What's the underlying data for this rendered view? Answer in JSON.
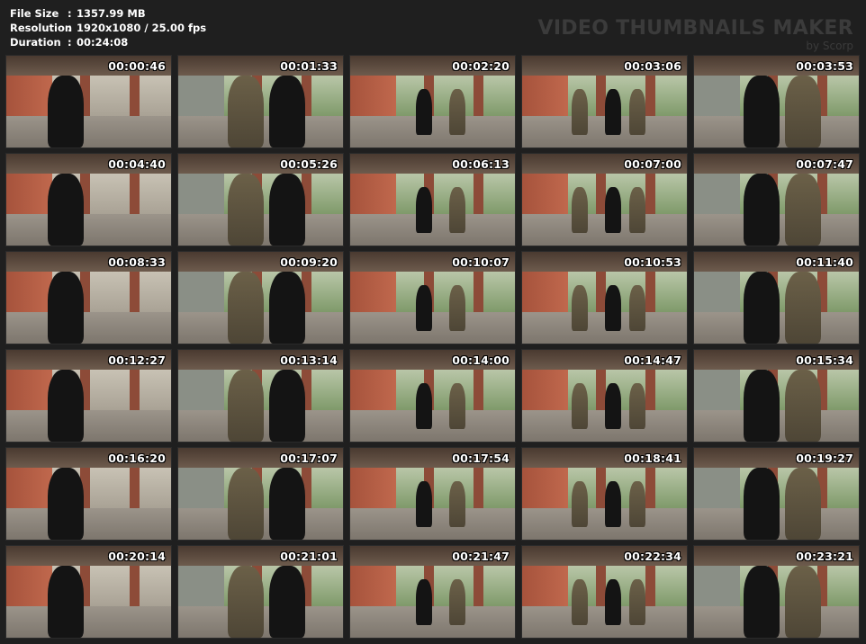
{
  "info": {
    "file_size_label": "File Size",
    "file_size_value": "1357.99 MB",
    "resolution_label": "Resolution",
    "resolution_value": "1920x1080 / 25.00 fps",
    "duration_label": "Duration",
    "duration_value": "00:24:08",
    "separator": ":"
  },
  "brand": {
    "title": "VIDEO THUMBNAILS MAKER",
    "subtitle": "by Scorp"
  },
  "thumbnails": [
    {
      "time": "00:00:46"
    },
    {
      "time": "00:01:33"
    },
    {
      "time": "00:02:20"
    },
    {
      "time": "00:03:06"
    },
    {
      "time": "00:03:53"
    },
    {
      "time": "00:04:40"
    },
    {
      "time": "00:05:26"
    },
    {
      "time": "00:06:13"
    },
    {
      "time": "00:07:00"
    },
    {
      "time": "00:07:47"
    },
    {
      "time": "00:08:33"
    },
    {
      "time": "00:09:20"
    },
    {
      "time": "00:10:07"
    },
    {
      "time": "00:10:53"
    },
    {
      "time": "00:11:40"
    },
    {
      "time": "00:12:27"
    },
    {
      "time": "00:13:14"
    },
    {
      "time": "00:14:00"
    },
    {
      "time": "00:14:47"
    },
    {
      "time": "00:15:34"
    },
    {
      "time": "00:16:20"
    },
    {
      "time": "00:17:07"
    },
    {
      "time": "00:17:54"
    },
    {
      "time": "00:18:41"
    },
    {
      "time": "00:19:27"
    },
    {
      "time": "00:20:14"
    },
    {
      "time": "00:21:01"
    },
    {
      "time": "00:21:47"
    },
    {
      "time": "00:22:34"
    },
    {
      "time": "00:23:21"
    }
  ]
}
